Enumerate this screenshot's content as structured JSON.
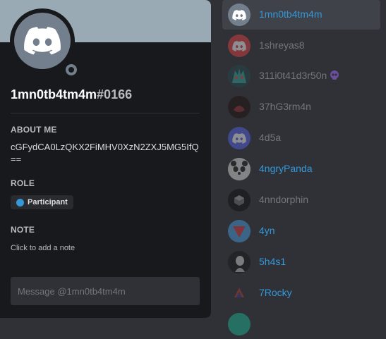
{
  "profile": {
    "username": "1mn0tb4tm4m",
    "discriminator": "#0166",
    "about_title": "ABOUT ME",
    "about_text": "cGFydCA0LzQKX2FiMHV0XzN2ZXJ5MG5IfQ==",
    "role_title": "ROLE",
    "role_label": "Participant",
    "role_color": "#3498db",
    "note_title": "NOTE",
    "note_placeholder": "Click to add a note",
    "message_placeholder": "Message @1mn0tb4tm4m",
    "banner_color": "#99aab5",
    "avatar_icon": "discord-logo-icon",
    "status": "offline"
  },
  "members": [
    {
      "name": "1mn0tb4tm4m",
      "avatar": "discord-logo-gray",
      "selected": true
    },
    {
      "name": "1shreyas8",
      "avatar": "discord-logo-red"
    },
    {
      "name": "311i0t41d3r50n",
      "avatar": "teal-monster-image",
      "badge": "purple-skull-icon"
    },
    {
      "name": "37hG3rm4n",
      "avatar": "red-dark-image"
    },
    {
      "name": "4d5a",
      "avatar": "discord-logo-blurple"
    },
    {
      "name": "4ngryPanda",
      "avatar": "panda-image"
    },
    {
      "name": "4nndorphin",
      "avatar": "dark-cube-image"
    },
    {
      "name": "4yn",
      "avatar": "red-triangle-image"
    },
    {
      "name": "5h4s1",
      "avatar": "statue-image"
    },
    {
      "name": "7Rocky",
      "avatar": "rocky-image"
    }
  ]
}
